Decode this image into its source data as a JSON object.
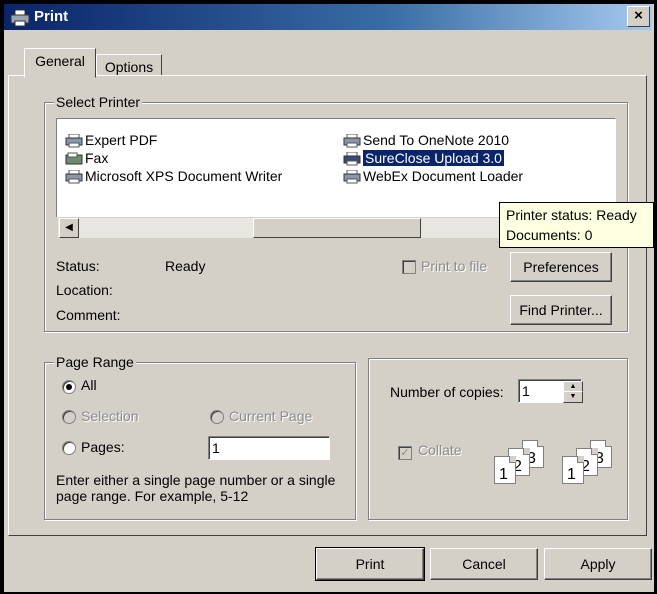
{
  "window": {
    "title": "Print",
    "close_label": "×"
  },
  "tabs": [
    {
      "label": "General",
      "active": true
    },
    {
      "label": "Options",
      "active": false
    }
  ],
  "select_printer": {
    "legend": "Select Printer",
    "printers": [
      {
        "name": "Expert PDF",
        "icon": "printer-icon",
        "selected": false
      },
      {
        "name": "Fax",
        "icon": "fax-icon",
        "selected": false
      },
      {
        "name": "Microsoft XPS Document Writer",
        "icon": "printer-icon",
        "selected": false
      },
      {
        "name": "Send To OneNote 2010",
        "icon": "printer-icon",
        "selected": false
      },
      {
        "name": "SureClose Upload 3.0",
        "icon": "printer-icon",
        "selected": true
      },
      {
        "name": "WebEx Document Loader",
        "icon": "printer-icon",
        "selected": false
      }
    ],
    "status_label": "Status:",
    "status_value": "Ready",
    "location_label": "Location:",
    "comment_label": "Comment:",
    "print_to_file_label": "Print to file",
    "preferences_label": "Preferences",
    "find_printer_label": "Find Printer...",
    "tooltip_line1": "Printer status: Ready",
    "tooltip_line2": "Documents: 0"
  },
  "page_range": {
    "legend": "Page Range",
    "all_label": "All",
    "selection_label": "Selection",
    "current_page_label": "Current Page",
    "pages_label": "Pages:",
    "pages_value": "1",
    "hint_line1": "Enter either a single page number or a single",
    "hint_line2": "page range.  For example, 5-12"
  },
  "copies": {
    "number_label": "Number of copies:",
    "number_value": "1",
    "collate_label": "Collate",
    "collate_checked": true,
    "page_numbers": [
      "1",
      "2",
      "3"
    ]
  },
  "footer": {
    "print_label": "Print",
    "cancel_label": "Cancel",
    "apply_label": "Apply"
  },
  "colors": {
    "dialog_bg": "#d4d0c8",
    "title_bar": "#0a246a",
    "selection": "#0a246a",
    "tooltip_bg": "#ffffe1"
  }
}
